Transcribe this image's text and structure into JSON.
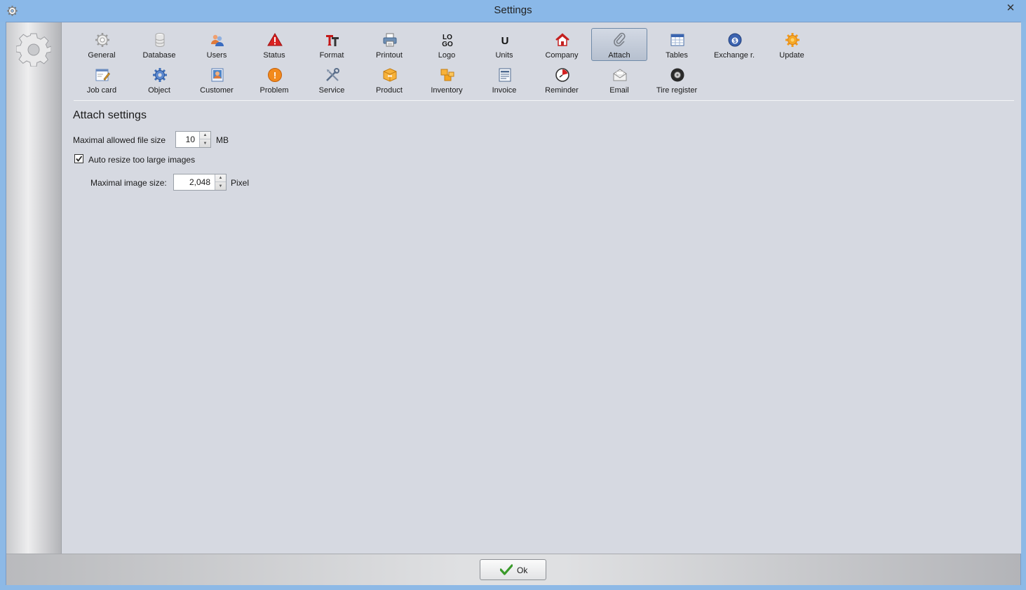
{
  "window": {
    "title": "Settings",
    "close_glyph": "✕"
  },
  "toolbar": {
    "items": [
      {
        "label": "General",
        "icon": "gear-icon"
      },
      {
        "label": "Database",
        "icon": "database-icon"
      },
      {
        "label": "Users",
        "icon": "users-icon"
      },
      {
        "label": "Status",
        "icon": "warning-triangle-icon"
      },
      {
        "label": "Format",
        "icon": "format-text-icon"
      },
      {
        "label": "Printout",
        "icon": "printer-icon"
      },
      {
        "label": "Logo",
        "icon": "logo-icon"
      },
      {
        "label": "Units",
        "icon": "units-icon"
      },
      {
        "label": "Company",
        "icon": "house-icon"
      },
      {
        "label": "Attach",
        "icon": "paperclip-icon",
        "selected": true
      },
      {
        "label": "Tables",
        "icon": "table-icon"
      },
      {
        "label": "Exchange r.",
        "icon": "exchange-globe-icon"
      },
      {
        "label": "Update",
        "icon": "update-gear-icon"
      },
      {
        "label": "Job card",
        "icon": "job-card-icon"
      },
      {
        "label": "Object",
        "icon": "object-gear-icon"
      },
      {
        "label": "Customer",
        "icon": "customer-icon"
      },
      {
        "label": "Problem",
        "icon": "problem-icon"
      },
      {
        "label": "Service",
        "icon": "tools-icon"
      },
      {
        "label": "Product",
        "icon": "box-icon"
      },
      {
        "label": "Inventory",
        "icon": "boxes-icon"
      },
      {
        "label": "Invoice",
        "icon": "invoice-icon"
      },
      {
        "label": "Reminder",
        "icon": "reminder-clock-icon"
      },
      {
        "label": "Email",
        "icon": "envelope-icon"
      },
      {
        "label": "Tire register",
        "icon": "tire-icon"
      }
    ],
    "logo_glyph_top": "LO",
    "logo_glyph_bottom": "GO",
    "units_glyph": "U",
    "problem_glyph": "!"
  },
  "attach": {
    "section_title": "Attach settings",
    "max_file_size_label": "Maximal allowed file size",
    "max_file_size_value": "10",
    "max_file_size_unit": "MB",
    "auto_resize_label": "Auto resize too large images",
    "auto_resize_checked": true,
    "max_image_size_label": "Maximal image size:",
    "max_image_size_value": "2,048",
    "max_image_size_unit": "Pixel"
  },
  "footer": {
    "ok_label": "Ok"
  },
  "colors": {
    "title_bar": "#8ab8e8",
    "content_bg": "#d6d9e1",
    "selected_item": "#b6c0cf",
    "ok_check": "#3a9a2a"
  }
}
